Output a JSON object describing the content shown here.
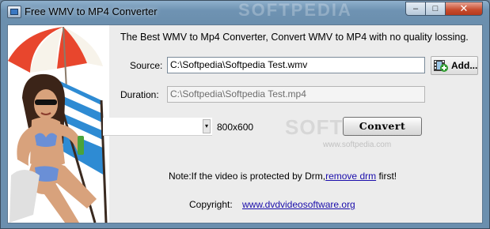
{
  "window": {
    "title": "Free WMV to MP4 Converter",
    "watermark": "SOFTPEDIA"
  },
  "controls": {
    "minimize": "–",
    "maximize": "□",
    "close": "✕"
  },
  "header": {
    "tagline": "The Best WMV to Mp4 Converter, Convert WMV to MP4 with no quality lossing."
  },
  "source": {
    "label": "Source:",
    "value": "C:\\Softpedia\\Softpedia Test.wmv"
  },
  "add_button": {
    "label": "Add...",
    "icon": "film-add-icon"
  },
  "duration": {
    "label": "Duration:",
    "value": "C:\\Softpedia\\Softpedia Test.mp4"
  },
  "resolution": {
    "value": "800x600"
  },
  "convert_button": {
    "label": "Convert"
  },
  "watermark": {
    "text": "SOFTPEDIA",
    "url": "www.softpedia.com"
  },
  "note": {
    "prefix": "Note:If the video is protected by Drm,",
    "link": "remove drm",
    "suffix": " first!"
  },
  "footer": {
    "copyright_label": "Copyright:",
    "website": "www.dvdvideosoftware.org"
  }
}
